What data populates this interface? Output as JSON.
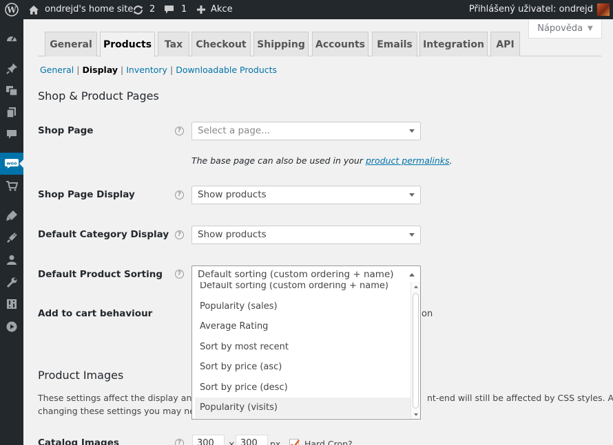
{
  "adminbar": {
    "site_name": "ondrejd's home site",
    "updates_count": "2",
    "comments_count": "1",
    "new_label": "Akce",
    "user_greeting": "Přihlášený uživatel: ondrejd"
  },
  "help_tab": {
    "label": "Nápověda"
  },
  "tabs": [
    {
      "label": "General"
    },
    {
      "label": "Products"
    },
    {
      "label": "Tax"
    },
    {
      "label": "Checkout"
    },
    {
      "label": "Shipping"
    },
    {
      "label": "Accounts"
    },
    {
      "label": "Emails"
    },
    {
      "label": "Integration"
    },
    {
      "label": "API"
    }
  ],
  "subnav": [
    {
      "label": "General"
    },
    {
      "label": "Display"
    },
    {
      "label": "Inventory"
    },
    {
      "label": "Downloadable Products"
    }
  ],
  "section1": {
    "title": "Shop & Product Pages",
    "shop_page": {
      "label": "Shop Page",
      "placeholder": "Select a page...",
      "desc_prefix": "The base page can also be used in your ",
      "desc_link": "product permalinks",
      "desc_suffix": "."
    },
    "shop_page_display": {
      "label": "Shop Page Display",
      "value": "Show products"
    },
    "default_category_display": {
      "label": "Default Category Display",
      "value": "Show products"
    },
    "default_product_sorting": {
      "label": "Default Product Sorting",
      "value": "Default sorting (custom ordering + name)",
      "options": [
        "Default sorting (custom ordering + name)",
        "Popularity (sales)",
        "Average Rating",
        "Sort by most recent",
        "Sort by price (asc)",
        "Sort by price (desc)",
        "Popularity (visits)"
      ]
    },
    "add_to_cart": {
      "label": "Add to cart behaviour",
      "partial_text": "on"
    }
  },
  "section2": {
    "title": "Product Images",
    "para_line1_a": "These settings affect the display and dir",
    "para_line1_b": "nt-end will still be affected by CSS styles. After",
    "para_line2": "changing these settings you may need t",
    "catalog_images": {
      "label": "Catalog Images",
      "width": "300",
      "height": "300",
      "times": "×",
      "unit": "px",
      "hard_crop": "Hard Crop?"
    }
  }
}
